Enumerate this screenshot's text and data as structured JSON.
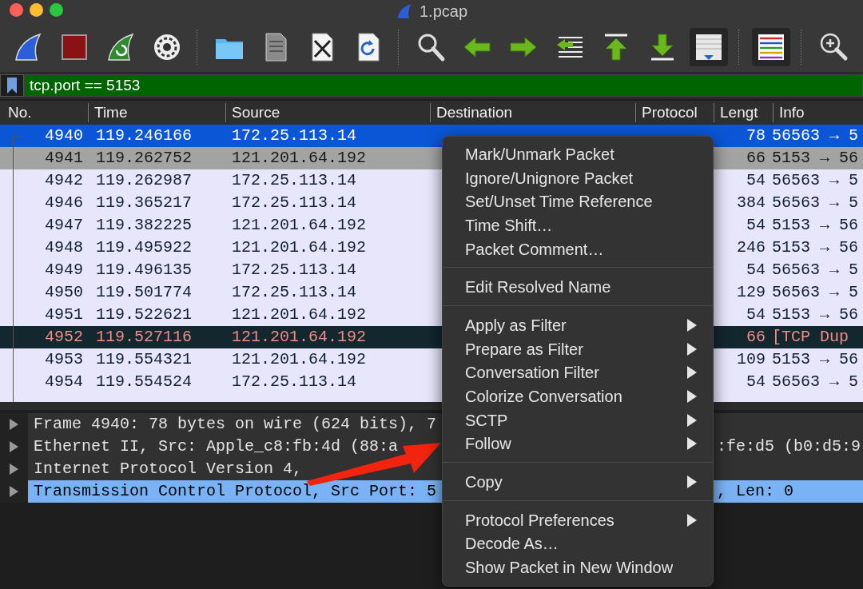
{
  "window": {
    "title": "1.pcap"
  },
  "toolbar": [
    [
      {
        "kind": "start",
        "pressed": false
      },
      {
        "kind": "stop",
        "pressed": false
      },
      {
        "kind": "restart",
        "pressed": false
      },
      {
        "kind": "options",
        "pressed": false
      }
    ],
    [
      {
        "kind": "open",
        "pressed": false
      },
      {
        "kind": "save",
        "pressed": false
      },
      {
        "kind": "close",
        "pressed": false
      },
      {
        "kind": "reload",
        "pressed": false
      }
    ],
    [
      {
        "kind": "find",
        "pressed": false
      },
      {
        "kind": "back",
        "pressed": false
      },
      {
        "kind": "forward",
        "pressed": false
      },
      {
        "kind": "goto",
        "pressed": false
      },
      {
        "kind": "first",
        "pressed": false
      },
      {
        "kind": "last",
        "pressed": false
      },
      {
        "kind": "autoscroll",
        "pressed": true
      }
    ],
    [
      {
        "kind": "colorize",
        "pressed": true
      }
    ],
    [
      {
        "kind": "zoom-in",
        "pressed": false
      }
    ]
  ],
  "filter": {
    "value": "tcp.port == 5153",
    "valid": true
  },
  "packet_list": {
    "columns": [
      "No.",
      "Time",
      "Source",
      "Destination",
      "Protocol",
      "Lengt",
      "Info"
    ],
    "rows": [
      {
        "no": "4940",
        "time": "119.246166",
        "source": "172.25.113.14",
        "length": "78",
        "info": "56563 → 5",
        "kind": "normal",
        "selected": true
      },
      {
        "no": "4941",
        "time": "119.262752",
        "source": "121.201.64.192",
        "length": "66",
        "info": "5153 → 56",
        "kind": "related",
        "selected": false
      },
      {
        "no": "4942",
        "time": "119.262987",
        "source": "172.25.113.14",
        "length": "54",
        "info": "56563 → 5",
        "kind": "normal",
        "selected": false
      },
      {
        "no": "4946",
        "time": "119.365217",
        "source": "172.25.113.14",
        "length": "384",
        "info": "56563 → 5",
        "kind": "normal",
        "selected": false
      },
      {
        "no": "4947",
        "time": "119.382225",
        "source": "121.201.64.192",
        "length": "54",
        "info": "5153 → 56",
        "kind": "normal",
        "selected": false
      },
      {
        "no": "4948",
        "time": "119.495922",
        "source": "121.201.64.192",
        "length": "246",
        "info": "5153 → 56",
        "kind": "normal",
        "selected": false
      },
      {
        "no": "4949",
        "time": "119.496135",
        "source": "172.25.113.14",
        "length": "54",
        "info": "56563 → 5",
        "kind": "normal",
        "selected": false
      },
      {
        "no": "4950",
        "time": "119.501774",
        "source": "172.25.113.14",
        "length": "129",
        "info": "56563 → 5",
        "kind": "normal",
        "selected": false
      },
      {
        "no": "4951",
        "time": "119.522621",
        "source": "121.201.64.192",
        "length": "54",
        "info": "5153 → 56",
        "kind": "normal",
        "selected": false
      },
      {
        "no": "4952",
        "time": "119.527116",
        "source": "121.201.64.192",
        "length": "66",
        "info": "[TCP Dup",
        "kind": "bad",
        "selected": false
      },
      {
        "no": "4953",
        "time": "119.554321",
        "source": "121.201.64.192",
        "length": "109",
        "info": "5153 → 56",
        "kind": "normal",
        "selected": false
      },
      {
        "no": "4954",
        "time": "119.554524",
        "source": "172.25.113.14",
        "length": "54",
        "info": "56563 → 5",
        "kind": "normal",
        "selected": false
      }
    ]
  },
  "packet_details": [
    {
      "text": "Frame 4940: 78 bytes on wire (624 bits), 7",
      "expanded": false,
      "selected": false
    },
    {
      "text": "Ethernet II, Src: Apple_c8:fb:4d (88:a",
      "text_right": ":fe:d5 (b0:d5:9",
      "expanded": false,
      "selected": false
    },
    {
      "text": "Internet Protocol Version 4,",
      "expanded": false,
      "selected": false
    },
    {
      "text": "Transmission Control Protocol, Src Port: 5",
      "text_right": ", Len: 0",
      "expanded": false,
      "selected": true
    }
  ],
  "context_menu": [
    [
      {
        "label": "Mark/Unmark Packet",
        "submenu": false
      },
      {
        "label": "Ignore/Unignore Packet",
        "submenu": false
      },
      {
        "label": "Set/Unset Time Reference",
        "submenu": false
      },
      {
        "label": "Time Shift…",
        "submenu": false
      },
      {
        "label": "Packet Comment…",
        "submenu": false
      }
    ],
    [
      {
        "label": "Edit Resolved Name",
        "submenu": false
      }
    ],
    [
      {
        "label": "Apply as Filter",
        "submenu": true
      },
      {
        "label": "Prepare as Filter",
        "submenu": true
      },
      {
        "label": "Conversation Filter",
        "submenu": true
      },
      {
        "label": "Colorize Conversation",
        "submenu": true
      },
      {
        "label": "SCTP",
        "submenu": true
      },
      {
        "label": "Follow",
        "submenu": true
      }
    ],
    [
      {
        "label": "Copy",
        "submenu": true
      }
    ],
    [
      {
        "label": "Protocol Preferences",
        "submenu": true
      },
      {
        "label": "Decode As…",
        "submenu": false
      },
      {
        "label": "Show Packet in New Window",
        "submenu": false
      }
    ]
  ],
  "annotations": [
    {
      "kind": "arrow"
    }
  ]
}
